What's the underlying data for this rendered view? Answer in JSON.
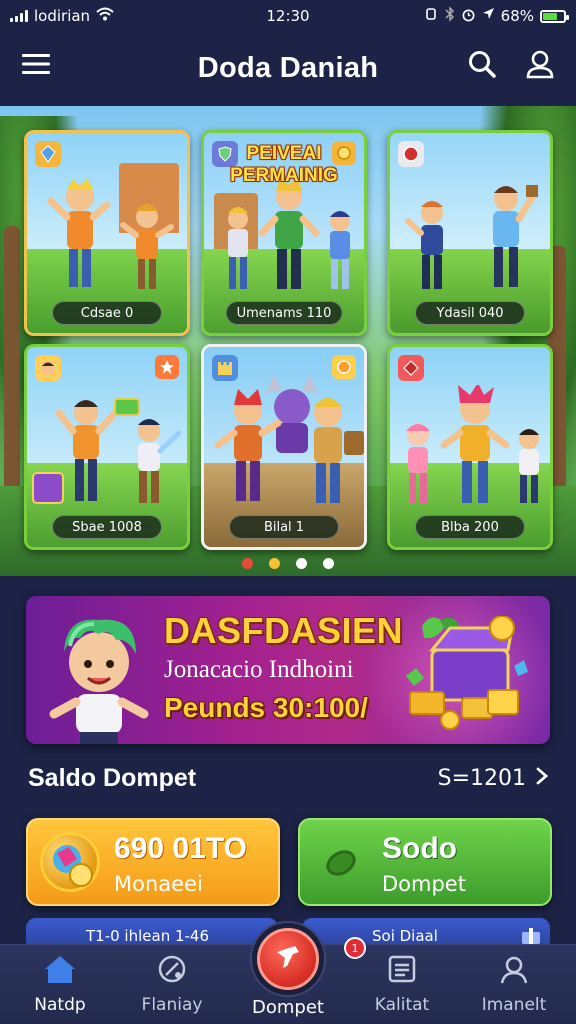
{
  "status_bar": {
    "carrier": "lodirian",
    "time": "12:30",
    "battery": "68%",
    "battery_level": 0.68
  },
  "header": {
    "title": "Doda Daniah",
    "menu_icon": "hamburger-menu-icon",
    "search_icon": "search-icon",
    "profile_icon": "user-icon"
  },
  "hero": {
    "cards": [
      {
        "label": "Cdsae 0"
      },
      {
        "title_line1": "PEIVEAI",
        "title_line2": "PERMAINIG",
        "label": "Umenams 110"
      },
      {
        "label": "Ydasil 040"
      },
      {
        "label": "Sbae 1008"
      },
      {
        "label": "Bilal 1"
      },
      {
        "label": "Blba 200"
      }
    ],
    "dots": [
      {
        "color": "#e84a3a",
        "active": false
      },
      {
        "color": "#f3c13a",
        "active": false
      },
      {
        "color": "#ffffff",
        "active": true
      },
      {
        "color": "#ffffff",
        "active": false
      }
    ]
  },
  "promo": {
    "title": "DASFDASIEN",
    "subtitle": "Jonacacio Indhoini",
    "amount": "Peunds 30:100/"
  },
  "wallet": {
    "title": "Saldo Dompet",
    "link_value": "S=1201",
    "cards": [
      {
        "main": "690 01TO",
        "sub": "Monaeei",
        "color": "#f5a623"
      },
      {
        "main": "Sodo",
        "sub": "Dompet",
        "color": "#4caf35"
      }
    ],
    "partial_rows": [
      {
        "text": "T1-0 ihlean 1-46"
      },
      {
        "text": "Soi Diaal"
      }
    ]
  },
  "bottom_nav": {
    "items": [
      {
        "label": "Natdp",
        "icon": "home-icon",
        "active": true
      },
      {
        "label": "Flaniay",
        "icon": "game-icon",
        "active": false
      },
      {
        "label": "Dompet",
        "icon": "wallet-icon",
        "active": false
      },
      {
        "label": "Kalitat",
        "icon": "document-icon",
        "active": false
      },
      {
        "label": "Imanelt",
        "icon": "profile-icon",
        "active": false
      }
    ],
    "notification_count": "1"
  },
  "colors": {
    "background": "#1c2346",
    "accent_orange": "#f5a623",
    "accent_green": "#4caf35",
    "accent_red": "#d62c24",
    "promo_purple": "#a3208f",
    "active_nav": "#3f7fe8"
  }
}
